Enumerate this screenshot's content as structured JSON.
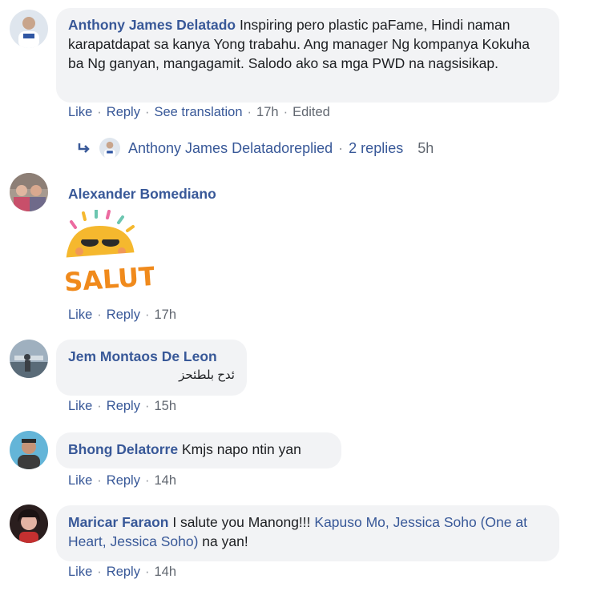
{
  "comments": [
    {
      "author": "Anthony James Delatado",
      "text": " Inspiring pero plastic paFame, Hindi naman karapatdapat sa kanya Yong trabahu. Ang manager Ng kompanya Kokuha ba Ng ganyan, mangagamit. Salodo ako sa mga PWD na nagsisikap.",
      "actions": {
        "like": "Like",
        "reply": "Reply",
        "see_translation": "See translation",
        "time": "17h",
        "edited": "Edited"
      },
      "replies": {
        "author": "Anthony James Delatado",
        "replied": " replied",
        "count": "2 replies",
        "time": "5h"
      }
    },
    {
      "author": "Alexander Bomediano",
      "sticker_text": "SALUT!",
      "actions": {
        "like": "Like",
        "reply": "Reply",
        "time": "17h"
      }
    },
    {
      "author": "Jem Montaos De Leon",
      "text": "ئدح بلطئحز",
      "actions": {
        "like": "Like",
        "reply": "Reply",
        "time": "15h"
      }
    },
    {
      "author": "Bhong Delatorre",
      "text": " Kmjs napo ntin yan",
      "actions": {
        "like": "Like",
        "reply": "Reply",
        "time": "14h"
      }
    },
    {
      "author": "Maricar Faraon",
      "text_before": " I salute you Manong!!! ",
      "link": "Kapuso Mo, Jessica Soho (One at Heart, Jessica Soho)",
      "text_after": " na yan!",
      "actions": {
        "like": "Like",
        "reply": "Reply",
        "time": "14h"
      }
    }
  ],
  "colors": {
    "link": "#385898",
    "bubble": "#f2f3f5",
    "text": "#1c1e21",
    "muted": "#616770",
    "sticker_sun": "#f5b82e",
    "sticker_text": "#f08a1c"
  },
  "icons": {
    "reply_arrow": "reply-arrow-icon"
  }
}
